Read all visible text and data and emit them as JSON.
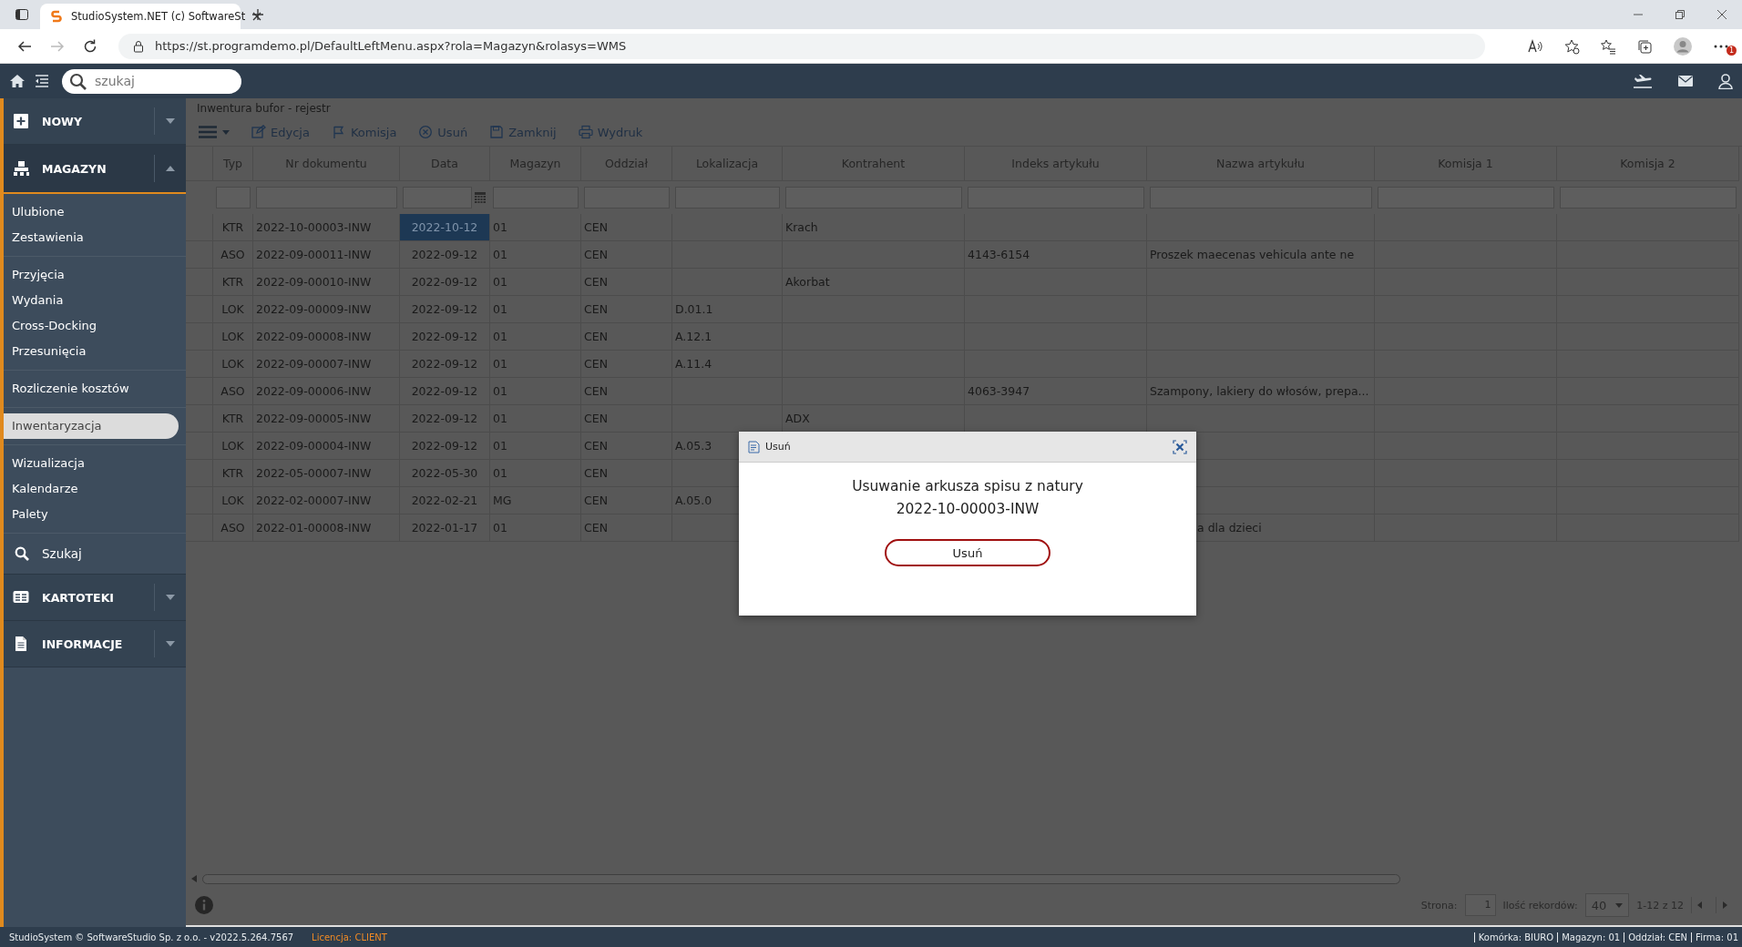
{
  "browser": {
    "tab_title": "StudioSystem.NET (c) SoftwareSt",
    "url": "https://st.programdemo.pl/DefaultLeftMenu.aspx?rola=Magazyn&rolasys=WMS",
    "notification_badge": "1"
  },
  "app_header": {
    "search": {
      "placeholder": "szukaj"
    }
  },
  "sidebar": {
    "sections": [
      {
        "kind": "header",
        "label": "NOWY",
        "expanded": false
      },
      {
        "kind": "header",
        "label": "MAGAZYN",
        "expanded": true
      },
      {
        "kind": "group",
        "items": [
          {
            "label": "Ulubione",
            "selected": false
          },
          {
            "label": "Zestawienia",
            "selected": false
          }
        ]
      },
      {
        "kind": "group",
        "items": [
          {
            "label": "Przyjęcia",
            "selected": false
          },
          {
            "label": "Wydania",
            "selected": false
          },
          {
            "label": "Cross-Docking",
            "selected": false
          },
          {
            "label": "Przesunięcia",
            "selected": false
          }
        ]
      },
      {
        "kind": "group",
        "items": [
          {
            "label": "Rozliczenie kosztów",
            "selected": false
          }
        ]
      },
      {
        "kind": "group",
        "items": [
          {
            "label": "Inwentaryzacja",
            "selected": true
          }
        ]
      },
      {
        "kind": "group",
        "items": [
          {
            "label": "Wizualizacja",
            "selected": false
          },
          {
            "label": "Kalendarze",
            "selected": false
          },
          {
            "label": "Palety",
            "selected": false
          }
        ]
      },
      {
        "kind": "link",
        "label": "Szukaj"
      },
      {
        "kind": "header",
        "label": "KARTOTEKI",
        "expanded": false
      },
      {
        "kind": "header",
        "label": "INFORMACJE",
        "expanded": false
      }
    ]
  },
  "content": {
    "title": "Inwentura bufor - rejestr",
    "toolbar": [
      "Edycja",
      "Komisja",
      "Usuń",
      "Zamknij",
      "Wydruk"
    ],
    "table": {
      "columns": [
        {
          "label": "Typ",
          "kind": "text"
        },
        {
          "label": "Nr dokumentu",
          "kind": "text"
        },
        {
          "label": "Data",
          "kind": "date"
        },
        {
          "label": "Magazyn",
          "kind": "text"
        },
        {
          "label": "Oddział",
          "kind": "text"
        },
        {
          "label": "Lokalizacja",
          "kind": "text"
        },
        {
          "label": "Kontrahent",
          "kind": "text"
        },
        {
          "label": "Indeks artykułu",
          "kind": "text"
        },
        {
          "label": "Nazwa artykułu",
          "kind": "text"
        },
        {
          "label": "Komisja 1",
          "kind": "text"
        },
        {
          "label": "Komisja 2",
          "kind": "text"
        }
      ],
      "rows": [
        {
          "selected": true,
          "cells": [
            "KTR",
            "2022-10-00003-INW",
            "2022-10-12",
            "01",
            "CEN",
            null,
            "Krach",
            null,
            null,
            null,
            null
          ]
        },
        {
          "selected": false,
          "cells": [
            "ASO",
            "2022-09-00011-INW",
            "2022-09-12",
            "01",
            "CEN",
            null,
            null,
            "4143-6154",
            "Proszek maecenas vehicula ante ne",
            null,
            null
          ]
        },
        {
          "selected": false,
          "cells": [
            "KTR",
            "2022-09-00010-INW",
            "2022-09-12",
            "01",
            "CEN",
            null,
            "Akorbat",
            null,
            null,
            null,
            null
          ]
        },
        {
          "selected": false,
          "cells": [
            "LOK",
            "2022-09-00009-INW",
            "2022-09-12",
            "01",
            "CEN",
            "D.01.1",
            null,
            null,
            null,
            null,
            null
          ]
        },
        {
          "selected": false,
          "cells": [
            "LOK",
            "2022-09-00008-INW",
            "2022-09-12",
            "01",
            "CEN",
            "A.12.1",
            null,
            null,
            null,
            null,
            null
          ]
        },
        {
          "selected": false,
          "cells": [
            "LOK",
            "2022-09-00007-INW",
            "2022-09-12",
            "01",
            "CEN",
            "A.11.4",
            null,
            null,
            null,
            null,
            null
          ]
        },
        {
          "selected": false,
          "cells": [
            "ASO",
            "2022-09-00006-INW",
            "2022-09-12",
            "01",
            "CEN",
            null,
            null,
            "4063-3947",
            "Szampony, lakiery do włosów, prepa...",
            null,
            null
          ]
        },
        {
          "selected": false,
          "cells": [
            "KTR",
            "2022-09-00005-INW",
            "2022-09-12",
            "01",
            "CEN",
            null,
            "ADX",
            null,
            null,
            null,
            null
          ]
        },
        {
          "selected": false,
          "cells": [
            "LOK",
            "2022-09-00004-INW",
            "2022-09-12",
            "01",
            "CEN",
            "A.05.3",
            null,
            null,
            null,
            null,
            null
          ]
        },
        {
          "selected": false,
          "cells": [
            "KTR",
            "2022-05-00007-INW",
            "2022-05-30",
            "01",
            "CEN",
            null,
            null,
            null,
            null,
            null,
            null
          ]
        },
        {
          "selected": false,
          "cells": [
            "LOK",
            "2022-02-00007-INW",
            "2022-02-21",
            "MG",
            "CEN",
            "A.05.0",
            null,
            null,
            null,
            null,
            null
          ]
        },
        {
          "selected": false,
          "cells": [
            "ASO",
            "2022-01-00008-INW",
            "2022-01-17",
            "01",
            "CEN",
            null,
            null,
            null,
            {
              "text": "a dla dzieci",
              "cut": true
            },
            null,
            null
          ]
        }
      ]
    },
    "pager": {
      "page_label": "Strona:",
      "page": "1",
      "records_label": "Ilość rekordów:",
      "records": "40",
      "range": "1-12 z 12"
    }
  },
  "dialog": {
    "title": "Usuń",
    "message": "Usuwanie arkusza spisu z natury",
    "document": "2022-10-00003-INW",
    "button": "Usuń"
  },
  "status_bar": {
    "copyright": "StudioSystem © SoftwareStudio Sp. z o.o. - v2022.5.264.7567",
    "license": "Licencja: CLIENT",
    "info": [
      "Komórka: BIURO",
      "Magazyn: 01",
      "Oddział: CEN",
      "Firma: 01"
    ]
  }
}
